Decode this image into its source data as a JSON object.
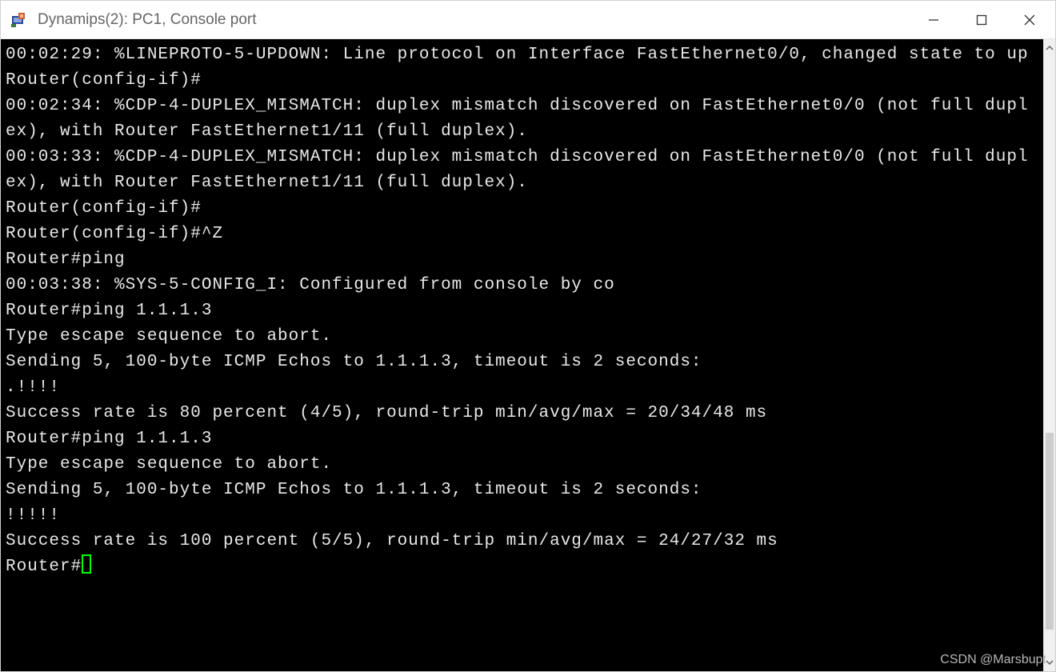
{
  "window": {
    "title": "Dynamips(2): PC1, Console port"
  },
  "terminal": {
    "lines": [
      "00:02:29: %LINEPROTO-5-UPDOWN: Line protocol on Interface FastEthernet0/0, changed state to up",
      "Router(config-if)#",
      "00:02:34: %CDP-4-DUPLEX_MISMATCH: duplex mismatch discovered on FastEthernet0/0 (not full duplex), with Router FastEthernet1/11 (full duplex).",
      "00:03:33: %CDP-4-DUPLEX_MISMATCH: duplex mismatch discovered on FastEthernet0/0 (not full duplex), with Router FastEthernet1/11 (full duplex).",
      "Router(config-if)#",
      "Router(config-if)#^Z",
      "Router#ping",
      "00:03:38: %SYS-5-CONFIG_I: Configured from console by co",
      "Router#ping 1.1.1.3",
      "",
      "Type escape sequence to abort.",
      "Sending 5, 100-byte ICMP Echos to 1.1.1.3, timeout is 2 seconds:",
      ".!!!!",
      "Success rate is 80 percent (4/5), round-trip min/avg/max = 20/34/48 ms",
      "Router#ping 1.1.1.3",
      "",
      "Type escape sequence to abort.",
      "Sending 5, 100-byte ICMP Echos to 1.1.1.3, timeout is 2 seconds:",
      "!!!!!",
      "Success rate is 100 percent (5/5), round-trip min/avg/max = 24/27/32 ms"
    ],
    "prompt": "Router#"
  },
  "watermark": "CSDN @Marsbupt"
}
